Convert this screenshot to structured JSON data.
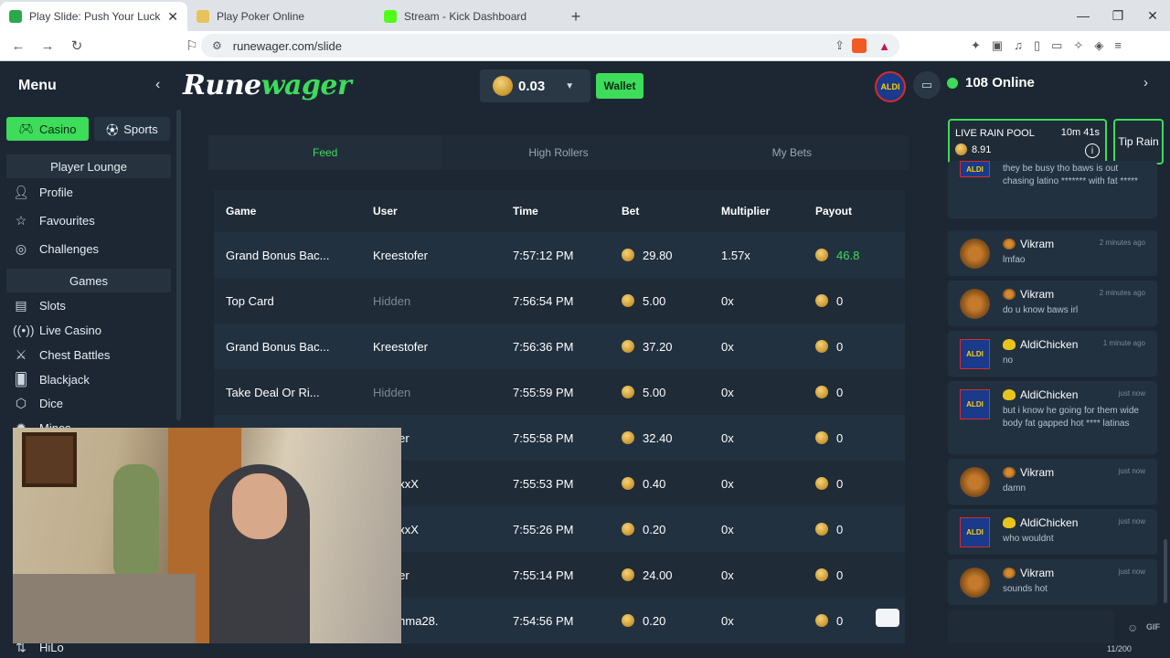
{
  "browser": {
    "tabs": [
      {
        "title": "Play Slide: Push Your Luck - Rune",
        "color": "#2aa84a",
        "active": true
      },
      {
        "title": "Play Poker Online",
        "color": "#e8c25a",
        "active": false
      },
      {
        "title": "Stream - Kick Dashboard",
        "color": "#53fc18",
        "active": false
      }
    ],
    "new_tab": "+",
    "url": "runewager.com/slide"
  },
  "header": {
    "menu_label": "Menu",
    "logo_main": "Rune",
    "logo_accent": "wager",
    "balance": "0.03",
    "wallet_label": "Wallet",
    "avatar_text": "ALDI",
    "online_count": "108 Online"
  },
  "sidebar": {
    "casino_label": "Casino",
    "sports_label": "Sports",
    "lounge_title": "Player Lounge",
    "lounge_items": [
      {
        "label": "Profile",
        "icon": "profile-icon"
      },
      {
        "label": "Favourites",
        "icon": "star-icon"
      },
      {
        "label": "Challenges",
        "icon": "target-icon"
      }
    ],
    "games_title": "Games",
    "game_items": [
      {
        "label": "Slots",
        "icon": "slots-icon"
      },
      {
        "label": "Live Casino",
        "icon": "live-icon"
      },
      {
        "label": "Chest Battles",
        "icon": "swords-icon"
      },
      {
        "label": "Blackjack",
        "icon": "cards-icon"
      },
      {
        "label": "Dice",
        "icon": "dice-icon"
      },
      {
        "label": "Mines",
        "icon": "mines-icon"
      },
      {
        "label": "HiLo",
        "icon": "hilo-icon"
      }
    ]
  },
  "feed": {
    "tabs": [
      "Feed",
      "High Rollers",
      "My Bets"
    ],
    "active_tab": "Feed",
    "columns": [
      "Game",
      "User",
      "Time",
      "Bet",
      "Multiplier",
      "Payout"
    ],
    "rows": [
      {
        "game": "Grand Bonus Bac...",
        "user": "Kreestofer",
        "time": "7:57:12 PM",
        "bet": "29.80",
        "mult": "1.57x",
        "payout": "46.8",
        "win": true,
        "hidden": false
      },
      {
        "game": "Top Card",
        "user": "Hidden",
        "time": "7:56:54 PM",
        "bet": "5.00",
        "mult": "0x",
        "payout": "0",
        "win": false,
        "hidden": true
      },
      {
        "game": "Grand Bonus Bac...",
        "user": "Kreestofer",
        "time": "7:56:36 PM",
        "bet": "37.20",
        "mult": "0x",
        "payout": "0",
        "win": false,
        "hidden": false
      },
      {
        "game": "Take Deal Or Ri...",
        "user": "Hidden",
        "time": "7:55:59 PM",
        "bet": "5.00",
        "mult": "0x",
        "payout": "0",
        "win": false,
        "hidden": true
      },
      {
        "game": "",
        "user": "estofer",
        "time": "7:55:58 PM",
        "bet": "32.40",
        "mult": "0x",
        "payout": "0",
        "win": false,
        "hidden": false
      },
      {
        "game": "",
        "user": "x666xxX",
        "time": "7:55:53 PM",
        "bet": "0.40",
        "mult": "0x",
        "payout": "0",
        "win": false,
        "hidden": false
      },
      {
        "game": "",
        "user": "x666xxX",
        "time": "7:55:26 PM",
        "bet": "0.20",
        "mult": "0x",
        "payout": "0",
        "win": false,
        "hidden": false
      },
      {
        "game": "",
        "user": "estofer",
        "time": "7:55:14 PM",
        "bet": "24.00",
        "mult": "0x",
        "payout": "0",
        "win": false,
        "hidden": false
      },
      {
        "game": "",
        "user": "kmomma28.",
        "time": "7:54:56 PM",
        "bet": "0.20",
        "mult": "0x",
        "payout": "0",
        "win": false,
        "hidden": false
      }
    ]
  },
  "chat": {
    "rain_label": "LIVE RAIN POOL",
    "rain_timer": "10m 41s",
    "rain_value": "8.91",
    "tip_rain": "Tip Rain",
    "messages": [
      {
        "user": "",
        "avatar": "aldi",
        "time": "",
        "text": "they be busy tho baws is out chasing latino ******* with fat *****"
      },
      {
        "user": "Vikram",
        "avatar": "viking",
        "time": "2 minutes ago",
        "text": "lmfao"
      },
      {
        "user": "Vikram",
        "avatar": "viking",
        "time": "2 minutes ago",
        "text": "do u know baws irl"
      },
      {
        "user": "AldiChicken",
        "avatar": "aldi",
        "time": "1 minute ago",
        "text": "no"
      },
      {
        "user": "AldiChicken",
        "avatar": "aldi",
        "time": "just now",
        "text": "but i know he going for them wide body fat gapped hot **** latinas"
      },
      {
        "user": "Vikram",
        "avatar": "viking",
        "time": "just now",
        "text": "damn"
      },
      {
        "user": "AldiChicken",
        "avatar": "aldi",
        "time": "just now",
        "text": "who wouldnt"
      },
      {
        "user": "Vikram",
        "avatar": "viking",
        "time": "just now",
        "text": "sounds hot"
      }
    ],
    "gif_label": "GIF",
    "char_count": "11/200"
  }
}
